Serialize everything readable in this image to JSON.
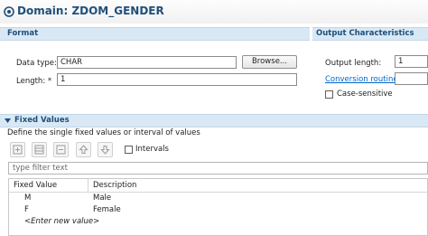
{
  "window": {
    "title": "Domain: ZDOM_GENDER"
  },
  "format": {
    "title": "Format",
    "data_type_label": "Data type: *",
    "data_type_value": "CHAR",
    "browse_label": "Browse...",
    "length_label": "Length: *",
    "length_value": "1"
  },
  "output": {
    "title": "Output Characteristics",
    "output_length_label": "Output length:",
    "output_length_value": "1",
    "conversion_routine_label": "Conversion routine:",
    "case_sensitive_label": "Case-sensitive",
    "case_sensitive_checked": false
  },
  "fixed_values": {
    "title": "Fixed Values",
    "description": "Define the single fixed values or interval of values",
    "intervals_label": "Intervals",
    "intervals_checked": false,
    "filter_placeholder": "type filter text",
    "columns": [
      "Fixed Value",
      "Description"
    ],
    "rows": [
      {
        "value": "M",
        "description": "Male"
      },
      {
        "value": "F",
        "description": "Female"
      }
    ],
    "new_row_hint": "<Enter new value>"
  },
  "icons": [
    "domain-icon",
    "add-row-icon",
    "insert-row-icon",
    "delete-row-icon",
    "move-up-icon",
    "move-down-icon",
    "collapse-icon"
  ],
  "colors": {
    "title": "#1f4f79",
    "section_header_bg": "#d9e8f5",
    "link": "#0066cc"
  }
}
